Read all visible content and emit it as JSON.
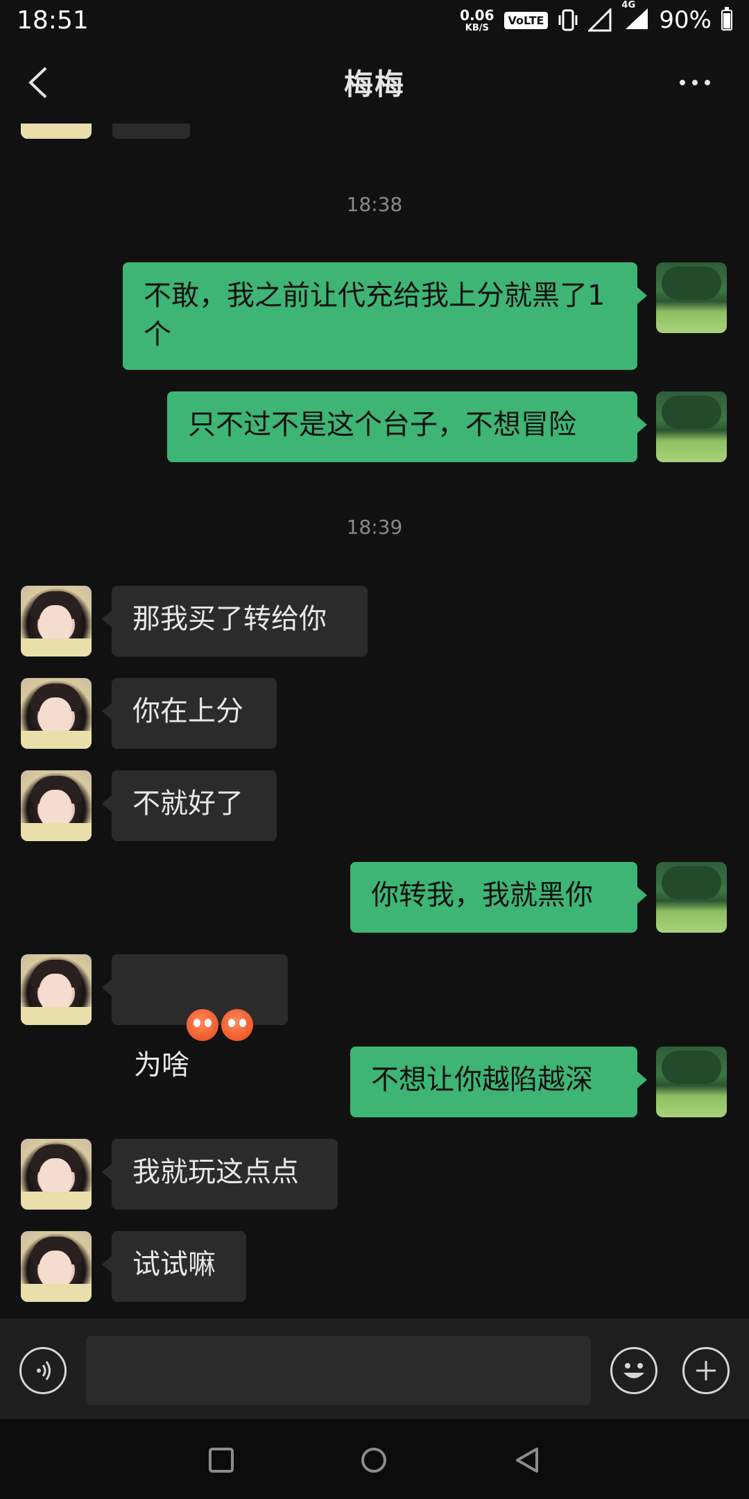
{
  "status_bar": {
    "time": "18:51",
    "net_speed_value": "0.06",
    "net_speed_unit": "KB/S",
    "volte": "VoLTE",
    "network": "4G",
    "battery": "90%"
  },
  "header": {
    "title": "梅梅"
  },
  "messages": [
    {
      "type": "timestamp",
      "text": "18:38"
    },
    {
      "type": "out",
      "text": "不敢，我之前让代充给我上分就黑了1个"
    },
    {
      "type": "out",
      "text": "只不过不是这个台子，不想冒险"
    },
    {
      "type": "timestamp",
      "text": "18:39"
    },
    {
      "type": "in",
      "text": "那我买了转给你"
    },
    {
      "type": "in",
      "text": "你在上分"
    },
    {
      "type": "in",
      "text": "不就好了"
    },
    {
      "type": "out",
      "text": "你转我，我就黑你"
    },
    {
      "type": "in",
      "text": "为啥",
      "emoji_prefix": [
        "hot-face-emoji",
        "hot-face-emoji"
      ]
    },
    {
      "type": "out",
      "text": "不想让你越陷越深"
    },
    {
      "type": "in",
      "text": "我就玩这点点"
    },
    {
      "type": "in",
      "text": "试试嘛"
    }
  ],
  "composer": {
    "input_value": "",
    "icons": [
      "voice-icon",
      "emoji-icon",
      "plus-icon"
    ]
  },
  "nav": {
    "icons": [
      "recents-icon",
      "home-icon",
      "back-icon"
    ]
  },
  "colors": {
    "background": "#111111",
    "bubble_out": "#3eb575",
    "bubble_in": "#2b2b2b",
    "timestamp": "#8a8a8a"
  }
}
